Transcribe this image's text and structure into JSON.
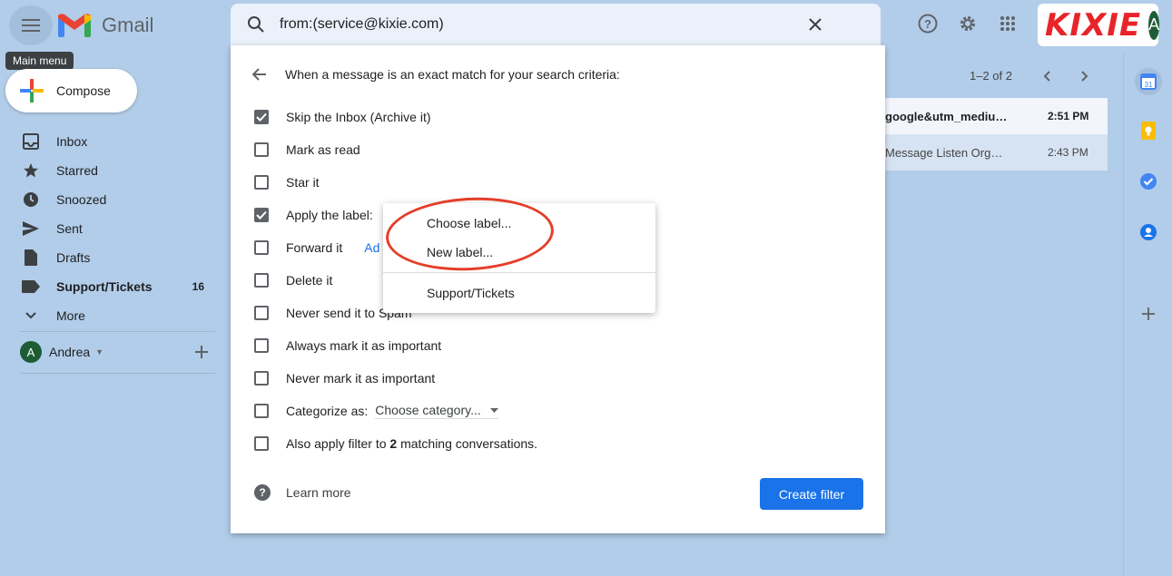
{
  "app": {
    "name": "Gmail",
    "tooltip": "Main menu"
  },
  "search": {
    "query": "from:(service@kixie.com)"
  },
  "brand": {
    "name": "KIXIE",
    "avatar_initial": "A"
  },
  "compose": {
    "label": "Compose"
  },
  "nav": [
    {
      "label": "Inbox",
      "icon": "inbox-icon"
    },
    {
      "label": "Starred",
      "icon": "star-icon"
    },
    {
      "label": "Snoozed",
      "icon": "clock-icon"
    },
    {
      "label": "Sent",
      "icon": "send-icon"
    },
    {
      "label": "Drafts",
      "icon": "draft-icon"
    },
    {
      "label": "Support/Tickets",
      "icon": "label-icon",
      "count": "16"
    },
    {
      "label": "More",
      "icon": "chevron-down-icon"
    }
  ],
  "user": {
    "name": "Andrea",
    "initial": "A"
  },
  "list": {
    "pager": "1–2 of 2",
    "rows": [
      {
        "subject": "google&utm_mediu…",
        "time": "2:51 PM",
        "unread": true
      },
      {
        "subject": "Message Listen Org…",
        "time": "2:43 PM",
        "unread": false
      }
    ]
  },
  "filter": {
    "header": "When a message is an exact match for your search criteria:",
    "options": [
      {
        "label": "Skip the Inbox (Archive it)",
        "checked": true
      },
      {
        "label": "Mark as read",
        "checked": false
      },
      {
        "label": "Star it",
        "checked": false
      },
      {
        "label": "Apply the label:",
        "checked": true
      },
      {
        "label": "Forward it",
        "checked": false,
        "link": "Ad"
      },
      {
        "label": "Delete it",
        "checked": false
      },
      {
        "label": "Never send it to Spam",
        "checked": false
      },
      {
        "label": "Always mark it as important",
        "checked": false
      },
      {
        "label": "Never mark it as important",
        "checked": false
      },
      {
        "label": "Categorize as:",
        "checked": false,
        "select": "Choose category..."
      },
      {
        "label_pre": "Also apply filter to ",
        "label_bold": "2",
        "label_post": " matching conversations.",
        "checked": false
      }
    ],
    "learn_more": "Learn more",
    "create_button": "Create filter"
  },
  "label_menu": {
    "items": [
      "Choose label...",
      "New label..."
    ],
    "existing": [
      "Support/Tickets"
    ]
  },
  "colors": {
    "accent": "#1a73e8",
    "background": "#b2cde9",
    "highlight_ring": "#e53e2a"
  }
}
